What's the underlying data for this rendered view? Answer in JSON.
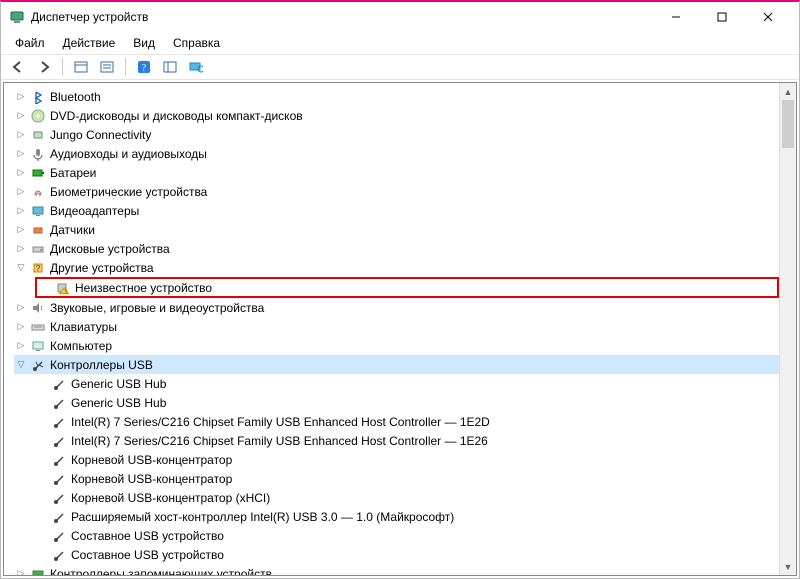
{
  "window": {
    "title": "Диспетчер устройств"
  },
  "menu": {
    "file": "Файл",
    "action": "Действие",
    "view": "Вид",
    "help": "Справка"
  },
  "tree": {
    "bluetooth": "Bluetooth",
    "dvd": "DVD-дисководы и дисководы компакт-дисков",
    "jungo": "Jungo Connectivity",
    "audio_io": "Аудиовходы и аудиовыходы",
    "batteries": "Батареи",
    "biometric": "Биометрические устройства",
    "video": "Видеоадаптеры",
    "sensors": "Датчики",
    "disk": "Дисковые устройства",
    "other": "Другие устройства",
    "other_children": {
      "unknown": "Неизвестное устройство"
    },
    "sound": "Звуковые, игровые и видеоустройства",
    "keyboards": "Клавиатуры",
    "computer": "Компьютер",
    "usb": "Контроллеры USB",
    "usb_children": {
      "hub1": "Generic USB Hub",
      "hub2": "Generic USB Hub",
      "intel_e2d": "Intel(R) 7 Series/C216 Chipset Family USB Enhanced Host Controller — 1E2D",
      "intel_e26": "Intel(R) 7 Series/C216 Chipset Family USB Enhanced Host Controller — 1E26",
      "root_hub1": "Корневой USB-концентратор",
      "root_hub2": "Корневой USB-концентратор",
      "root_hub_xhci": "Корневой USB-концентратор (xHCI)",
      "xhci_ext": "Расширяемый хост-контроллер Intel(R) USB 3.0 — 1.0 (Майкрософт)",
      "composite1": "Составное USB устройство",
      "composite2": "Составное USB устройство"
    },
    "storage_ctrl": "Контроллеры запоминающих устройств"
  }
}
